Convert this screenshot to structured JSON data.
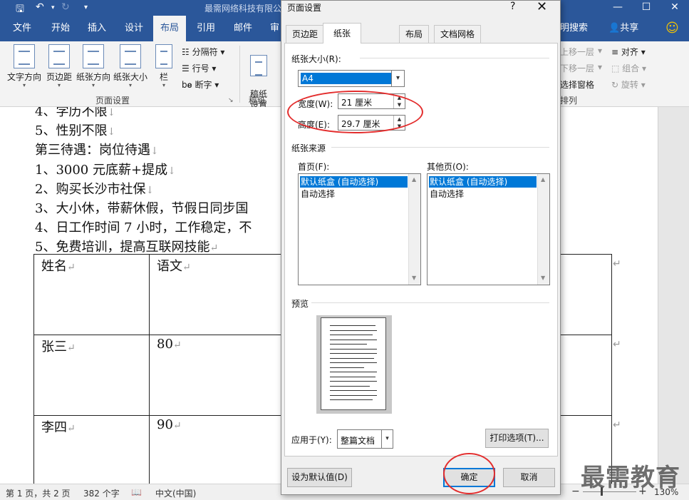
{
  "window": {
    "title": "最需网络科技有限公",
    "minimize": "—",
    "maximize": "☐",
    "close": "✕"
  },
  "ribbon_tabs": [
    "文件",
    "开始",
    "插入",
    "设计",
    "布局",
    "引用",
    "邮件",
    "审"
  ],
  "ribbon_right": {
    "tell_me": "明搜索",
    "share": "共享"
  },
  "ribbon": {
    "text_direction": "文字方向",
    "margins": "页边距",
    "orientation": "纸张方向",
    "size": "纸张大小",
    "columns": "栏",
    "breaks": "分隔符",
    "line_numbers": "行号",
    "hyphenation": "断字",
    "draft": "稿纸\n设置",
    "group_page_setup": "页面设置",
    "group_draft": "稿纸",
    "bring_forward": "上移一层",
    "send_backward": "下移一层",
    "selection_pane": "选择窗格",
    "align": "对齐",
    "group": "组合",
    "rotate": "旋转",
    "group_arrange": "排列"
  },
  "document": {
    "lines": [
      "4、学历不限",
      "5、性别不限",
      "第三待遇：岗位待遇",
      "1、3000 元底薪+提成",
      "2、购买长沙市社保",
      "3、大小休，带薪休假，节假日同步国",
      "4、日工作时间 7 小时，工作稳定，不",
      "5、免费培训，提高互联网技能"
    ],
    "table": [
      [
        "姓名",
        "语文"
      ],
      [
        "张三",
        "80"
      ],
      [
        "李四",
        "90"
      ]
    ]
  },
  "status": {
    "page": "第 1 页，共 2 页",
    "words": "382 个字",
    "language": "中文(中国)",
    "zoom": "130%"
  },
  "dialog": {
    "title": "页面设置",
    "help": "?",
    "close": "✕",
    "tabs": [
      "页边距",
      "纸张",
      "布局",
      "文档网格"
    ],
    "active_tab": "纸张",
    "paper_size_label": "纸张大小(R):",
    "paper_size_value": "A4",
    "width_label": "宽度(W):",
    "width_value": "21 厘米",
    "height_label": "高度(E):",
    "height_value": "29.7 厘米",
    "paper_source_label": "纸张来源",
    "first_page_label": "首页(F):",
    "other_pages_label": "其他页(O):",
    "first_page_items": [
      "默认纸盒 (自动选择)",
      "自动选择"
    ],
    "other_pages_items": [
      "默认纸盒 (自动选择)",
      "自动选择"
    ],
    "preview_label": "预览",
    "apply_to_label": "应用于(Y):",
    "apply_to_value": "整篇文档",
    "print_options": "打印选项(T)...",
    "set_default": "设为默认值(D)",
    "ok": "确定",
    "cancel": "取消"
  },
  "watermark": "最需教育"
}
